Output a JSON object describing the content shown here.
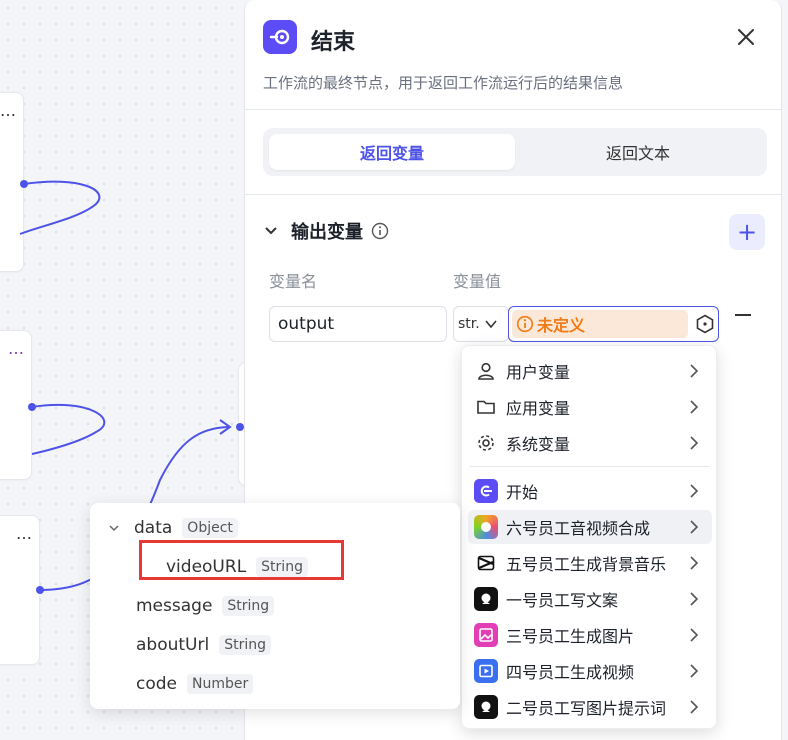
{
  "panel": {
    "title": "结束",
    "description": "工作流的最终节点，用于返回工作流运行后的结果信息",
    "tabs": [
      {
        "label": "返回变量",
        "active": true
      },
      {
        "label": "返回文本",
        "active": false
      }
    ]
  },
  "output_section": {
    "title": "输出变量",
    "col_name": "变量名",
    "col_value": "变量值",
    "row": {
      "name": "output",
      "type": "str.",
      "value_tag": "未定义"
    }
  },
  "variable_menu": {
    "groups": [
      {
        "label": "用户变量",
        "icon": "user-icon"
      },
      {
        "label": "应用变量",
        "icon": "folder-icon"
      },
      {
        "label": "系统变量",
        "icon": "gear-icon"
      }
    ],
    "nodes": [
      {
        "label": "开始",
        "icon": "start-node-icon",
        "color": "#5b4cf6"
      },
      {
        "label": "六号员工音视频合成",
        "icon": "plugin-icon",
        "hovered": true
      },
      {
        "label": "五号员工生成背景音乐",
        "icon": "capcut-icon",
        "color": "#111111"
      },
      {
        "label": "一号员工写文案",
        "icon": "bot-icon",
        "color": "#111111"
      },
      {
        "label": "三号员工生成图片",
        "icon": "image-icon",
        "color": "#e13fb3"
      },
      {
        "label": "四号员工生成视频",
        "icon": "video-icon",
        "color": "#3a6ff0"
      },
      {
        "label": "二号员工写图片提示词",
        "icon": "bot-icon",
        "color": "#111111"
      }
    ]
  },
  "output_tree": {
    "root": {
      "name": "data",
      "type": "Object"
    },
    "children": [
      {
        "name": "videoURL",
        "type": "String",
        "highlighted": true
      }
    ],
    "fields": [
      {
        "name": "message",
        "type": "String"
      },
      {
        "name": "aboutUrl",
        "type": "String"
      },
      {
        "name": "code",
        "type": "Number"
      }
    ]
  },
  "colors": {
    "accent": "#4d53e8",
    "warning": "#f27b15",
    "highlight": "#e53935"
  }
}
